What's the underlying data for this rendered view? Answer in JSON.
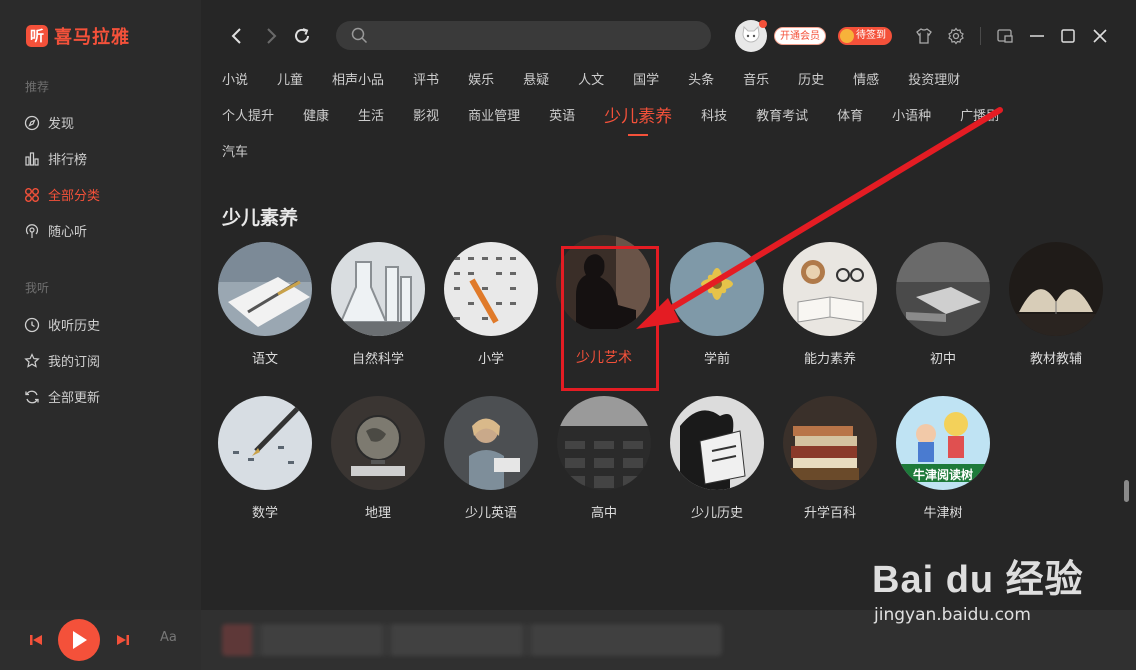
{
  "app": {
    "logo_mark": "听",
    "logo_text": "喜马拉雅"
  },
  "sidebar": {
    "section_recommend": "推荐",
    "items_recommend": [
      {
        "label": "发现",
        "icon": "compass-icon"
      },
      {
        "label": "排行榜",
        "icon": "chart-icon"
      },
      {
        "label": "全部分类",
        "icon": "grid-icon",
        "active": true
      },
      {
        "label": "随心听",
        "icon": "radio-icon"
      }
    ],
    "section_mine": "我听",
    "items_mine": [
      {
        "label": "收听历史",
        "icon": "clock-icon"
      },
      {
        "label": "我的订阅",
        "icon": "star-icon"
      },
      {
        "label": "全部更新",
        "icon": "refresh-icon"
      }
    ]
  },
  "topbar": {
    "vip_label": "开通会员",
    "sign_label": "待签到",
    "search_placeholder": ""
  },
  "categories": {
    "row1": [
      "小说",
      "儿童",
      "相声小品",
      "评书",
      "娱乐",
      "悬疑",
      "人文",
      "国学",
      "头条",
      "音乐",
      "历史",
      "情感",
      "投资理财"
    ],
    "row2": [
      "个人提升",
      "健康",
      "生活",
      "影视",
      "商业管理",
      "英语",
      "少儿素养",
      "科技",
      "教育考试",
      "体育",
      "小语种",
      "广播剧"
    ],
    "row3": [
      "汽车"
    ],
    "active": "少儿素养"
  },
  "section": {
    "title": "少儿素养"
  },
  "tiles_row1": [
    "语文",
    "自然科学",
    "小学",
    "少儿艺术",
    "学前",
    "能力素养",
    "初中",
    "教材教辅"
  ],
  "tiles_row2": [
    "数学",
    "地理",
    "少儿英语",
    "高中",
    "少儿历史",
    "升学百科",
    "牛津树"
  ],
  "tile_art_text": {
    "oxford": "牛津阅读树"
  },
  "player": {
    "aa_label": "Aa"
  },
  "watermark": {
    "logo": "Bai du 经验",
    "url": "jingyan.baidu.com"
  },
  "colors": {
    "accent": "#f4513a",
    "background": "#262626",
    "sidebar": "#2b2b2b",
    "highlight_box": "#e41c23"
  }
}
